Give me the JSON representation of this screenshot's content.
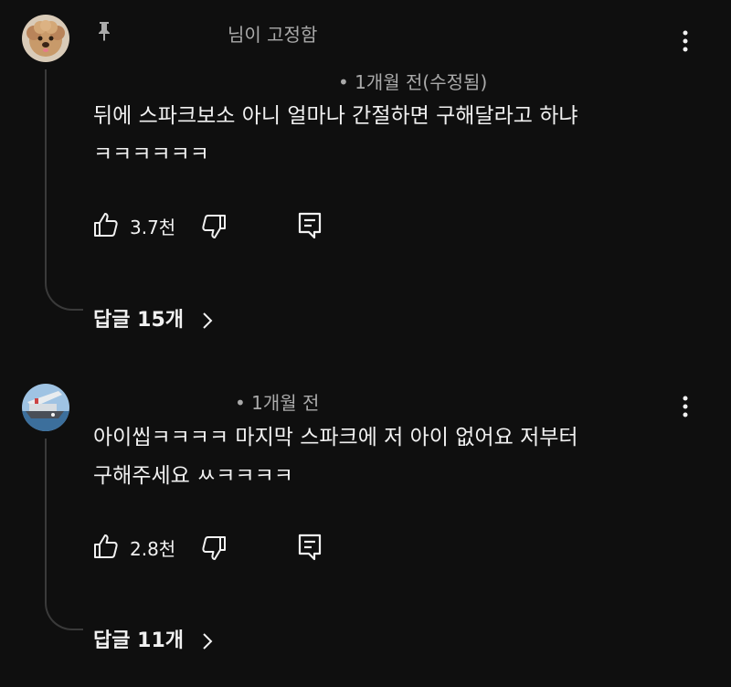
{
  "comments": [
    {
      "pinned_label": "님이 고정함",
      "meta": "• 1개월 전(수정됨)",
      "text": "뒤에 스파크보소 아니 얼마나 간절하면 구해달라고 하냐\nㅋㅋㅋㅋㅋㅋ",
      "likes": "3.7천",
      "replies_label": "답글 15개",
      "avatar_icon": "dog-avatar"
    },
    {
      "meta": "• 1개월 전",
      "text": "아이씹ㅋㅋㅋㅋ 마지막 스파크에 저 아이 없어요 저부터\n구해주세요 ㅆㅋㅋㅋㅋ",
      "likes": "2.8천",
      "replies_label": "답글 11개",
      "avatar_icon": "ship-avatar"
    }
  ],
  "colors": {
    "background": "#0f0f0f",
    "primary_text": "#f1f1f1",
    "secondary_text": "#aaaaaa",
    "thread_line": "#3a3a3a"
  }
}
